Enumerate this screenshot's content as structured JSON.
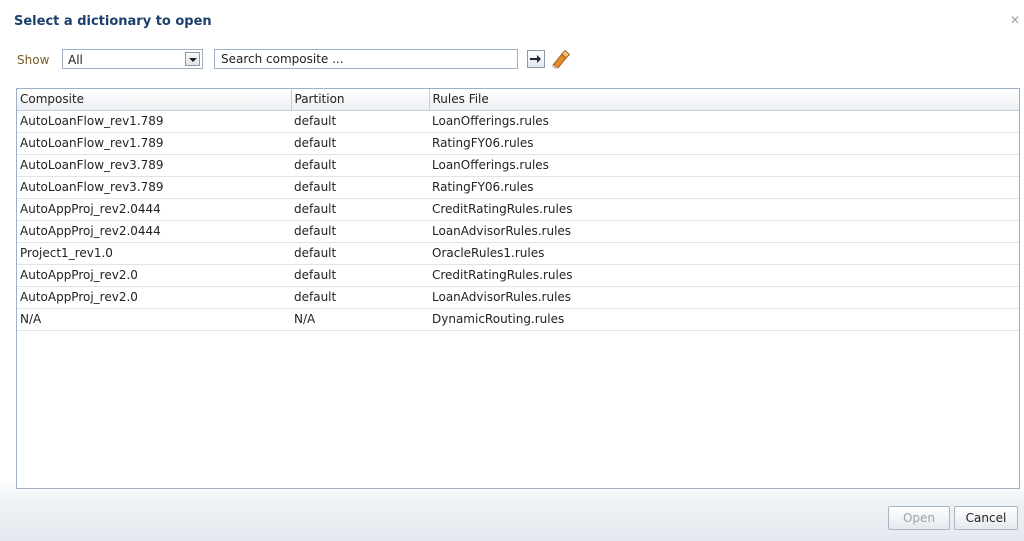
{
  "dialog": {
    "title": "Select a dictionary to open",
    "close_symbol": "✕"
  },
  "toolbar": {
    "show_label": "Show",
    "show_value": "All",
    "search_placeholder": "Search composite ..."
  },
  "icons": {
    "go": "arrow-right-icon",
    "clear": "eraser-icon",
    "dropdown": "chevron-down-icon"
  },
  "table": {
    "columns": [
      "Composite",
      "Partition",
      "Rules File"
    ],
    "rows": [
      [
        "AutoLoanFlow_rev1.789",
        "default",
        "LoanOfferings.rules"
      ],
      [
        "AutoLoanFlow_rev1.789",
        "default",
        "RatingFY06.rules"
      ],
      [
        "AutoLoanFlow_rev3.789",
        "default",
        "LoanOfferings.rules"
      ],
      [
        "AutoLoanFlow_rev3.789",
        "default",
        "RatingFY06.rules"
      ],
      [
        "AutoAppProj_rev2.0444",
        "default",
        "CreditRatingRules.rules"
      ],
      [
        "AutoAppProj_rev2.0444",
        "default",
        "LoanAdvisorRules.rules"
      ],
      [
        "Project1_rev1.0",
        "default",
        "OracleRules1.rules"
      ],
      [
        "AutoAppProj_rev2.0",
        "default",
        "CreditRatingRules.rules"
      ],
      [
        "AutoAppProj_rev2.0",
        "default",
        "LoanAdvisorRules.rules"
      ],
      [
        "N/A",
        "N/A",
        "DynamicRouting.rules"
      ]
    ]
  },
  "footer": {
    "open_label": "Open",
    "cancel_label": "Cancel"
  },
  "colors": {
    "title": "#1c3f6b",
    "show_label": "#7a5d2b",
    "border": "#9fb0c3",
    "disabled_text": "#9aa3ad"
  }
}
